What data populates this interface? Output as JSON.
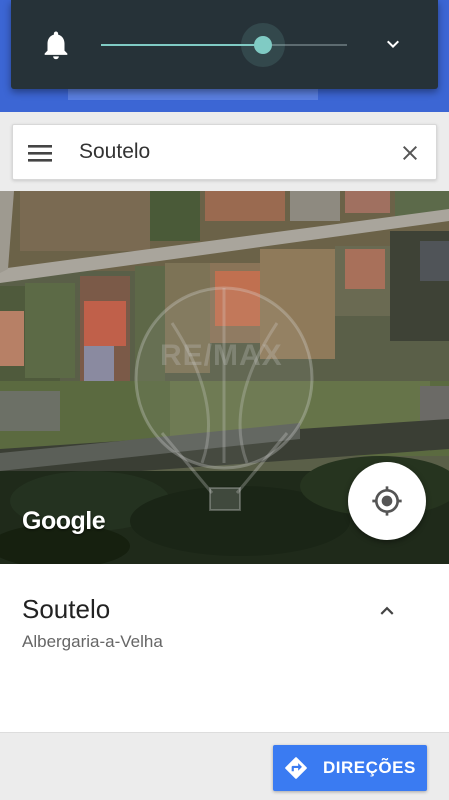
{
  "volume_panel": {
    "level": 0.66,
    "bell_icon": "bell-icon",
    "expand_icon": "chevron-down-icon",
    "accent_color": "#80cbc4"
  },
  "search": {
    "value": "Soutelo",
    "menu_icon": "hamburger-menu-icon",
    "clear_icon": "close-icon"
  },
  "map": {
    "attribution": "Google",
    "watermark_text": "RE/MAX",
    "locate_icon": "my-location-icon"
  },
  "place": {
    "name": "Soutelo",
    "locality": "Albergaria-a-Velha",
    "collapse_icon": "chevron-up-icon"
  },
  "actions": {
    "directions_label": "DIREÇÕES",
    "directions_icon": "directions-icon",
    "button_color": "#3a7bf2"
  }
}
